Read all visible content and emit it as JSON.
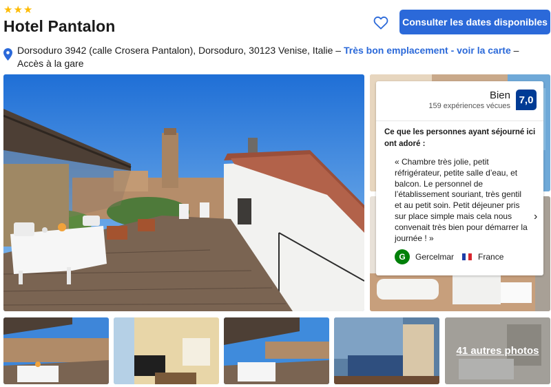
{
  "header": {
    "stars": [
      "star-icon",
      "star-icon",
      "star-icon"
    ],
    "title": "Hotel Pantalon",
    "cta_label": "Consulter les dates disponibles",
    "favorite_icon": "heart-icon"
  },
  "address": {
    "pin_icon": "map-pin-icon",
    "text": "Dorsoduro 3942 (calle Crosera Pantalon), Dorsoduro, 30123 Venise, Italie",
    "separator1": " – ",
    "location_link": "Très bon emplacement - voir la carte",
    "separator2": " – ",
    "station_text": "Accès à la gare"
  },
  "review": {
    "score_word": "Bien",
    "experiences": "159 expériences vécues",
    "score": "7,0",
    "heading": "Ce que les personnes ayant séjourné ici ont adoré :",
    "quote": "« Chambre très jolie, petit réfrigérateur, petite salle d’eau, et balcon. Le personnel de l’établissement souriant, très gentil et au petit soin. Petit déjeuner pris sur place simple mais cela nous convenait très bien pour démarrer la journée ! »",
    "next_icon": "chevron-right-icon",
    "reviewer_initial": "G",
    "reviewer_name": "Gercelmar",
    "country": "France"
  },
  "gallery": {
    "more_photos": "41 autres photos"
  },
  "colors": {
    "brand_blue": "#2b69d9",
    "score_blue": "#003b95",
    "star_yellow": "#febb02",
    "avatar_green": "#008009"
  }
}
